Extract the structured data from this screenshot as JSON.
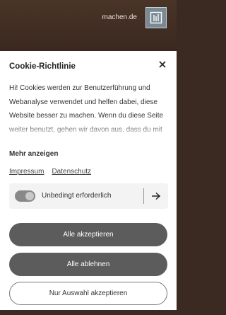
{
  "background": {
    "site_text": "machen.de",
    "menu_icon": "bookshelf-icon"
  },
  "modal": {
    "title": "Cookie-Richtlinie",
    "close_icon": "close-icon",
    "body": "Hi! Cookies werden zur Benutzerführung und Webanalyse verwendet und helfen dabei, diese Website besser zu machen. Wenn du diese Seite weiter benutzt, gehen wir davon aus, dass du mit den machen.de Datenschutzbestimmungen",
    "more_label": "Mehr anzeigen",
    "links": [
      "Impressum",
      "Datenschutz"
    ],
    "consent": {
      "label": "Unbedingt erforderlich",
      "enabled": true,
      "arrow_icon": "arrow-right-icon"
    },
    "buttons": {
      "accept_all": "Alle akzeptieren",
      "reject_all": "Alle ablehnen",
      "accept_selection": "Nur Auswahl akzeptieren"
    }
  },
  "colors": {
    "primary_button": "#5c5c5c",
    "background_header": "#3b2a22",
    "toggle_on": "#888888"
  }
}
